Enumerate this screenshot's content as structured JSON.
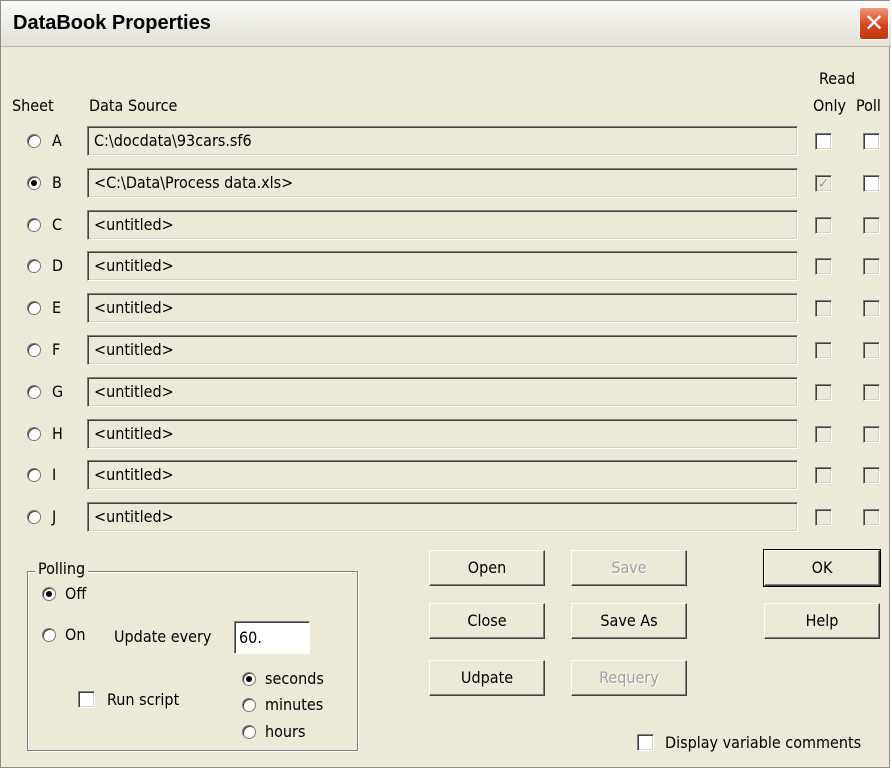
{
  "window": {
    "title": "DataBook Properties",
    "close_symbol": "✕"
  },
  "headers": {
    "sheet": "Sheet",
    "data_source": "Data Source",
    "read_only": "Read Only",
    "read_only_l1": "Read",
    "read_only_l2": "Only",
    "poll": "Poll"
  },
  "sheets": [
    {
      "letter": "A",
      "source": "C:\\docdata\\93cars.sf6",
      "selected": false,
      "read_only": false,
      "read_only_enabled": true,
      "poll": false,
      "poll_enabled": true
    },
    {
      "letter": "B",
      "source": "<C:\\Data\\Process data.xls>",
      "selected": true,
      "read_only": true,
      "read_only_enabled": false,
      "poll": false,
      "poll_enabled": true
    },
    {
      "letter": "C",
      "source": "<untitled>",
      "selected": false,
      "read_only": false,
      "read_only_enabled": false,
      "poll": false,
      "poll_enabled": false
    },
    {
      "letter": "D",
      "source": "<untitled>",
      "selected": false,
      "read_only": false,
      "read_only_enabled": false,
      "poll": false,
      "poll_enabled": false
    },
    {
      "letter": "E",
      "source": "<untitled>",
      "selected": false,
      "read_only": false,
      "read_only_enabled": false,
      "poll": false,
      "poll_enabled": false
    },
    {
      "letter": "F",
      "source": "<untitled>",
      "selected": false,
      "read_only": false,
      "read_only_enabled": false,
      "poll": false,
      "poll_enabled": false
    },
    {
      "letter": "G",
      "source": "<untitled>",
      "selected": false,
      "read_only": false,
      "read_only_enabled": false,
      "poll": false,
      "poll_enabled": false
    },
    {
      "letter": "H",
      "source": "<untitled>",
      "selected": false,
      "read_only": false,
      "read_only_enabled": false,
      "poll": false,
      "poll_enabled": false
    },
    {
      "letter": "I",
      "source": "<untitled>",
      "selected": false,
      "read_only": false,
      "read_only_enabled": false,
      "poll": false,
      "poll_enabled": false
    },
    {
      "letter": "J",
      "source": "<untitled>",
      "selected": false,
      "read_only": false,
      "read_only_enabled": false,
      "poll": false,
      "poll_enabled": false
    }
  ],
  "polling": {
    "group_label": "Polling",
    "off_label": "Off",
    "on_label": "On",
    "mode": "Off",
    "update_every_label": "Update every",
    "update_every_value": "60.",
    "units": [
      "seconds",
      "minutes",
      "hours"
    ],
    "selected_unit": "seconds",
    "run_script_label": "Run script",
    "run_script_checked": false
  },
  "buttons": {
    "open": "Open",
    "save": "Save",
    "ok": "OK",
    "close": "Close",
    "save_as": "Save As",
    "help": "Help",
    "update": "Udpate",
    "requery": "Requery"
  },
  "display_comments": {
    "label": "Display variable comments",
    "checked": false
  },
  "colors": {
    "dialog_bg": "#ece9d8",
    "close_button": "#d6451e",
    "disabled_text": "#a0a0a0"
  }
}
